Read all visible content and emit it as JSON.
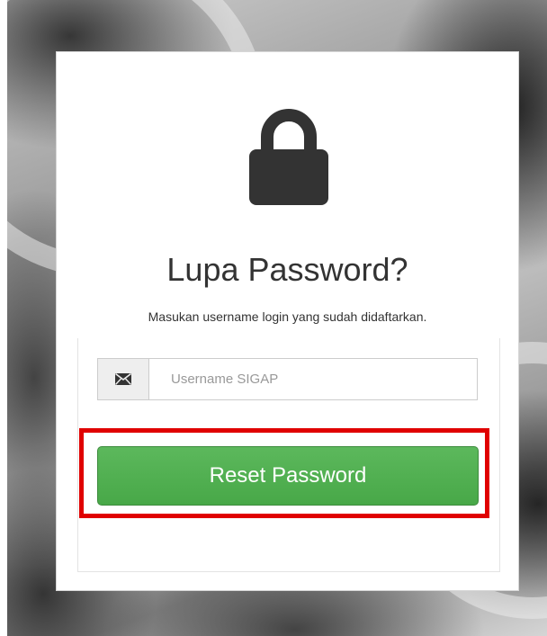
{
  "colors": {
    "button_bg": "#5cb85c",
    "button_text": "#ffffff",
    "highlight_border": "#e00000",
    "lock_icon": "#333333",
    "title_text": "#333333"
  },
  "icons": {
    "header": "lock-icon",
    "input_addon": "envelope-icon"
  },
  "card": {
    "title": "Lupa Password?",
    "subtitle": "Masukan username login yang sudah didaftarkan."
  },
  "form": {
    "username_placeholder": "Username SIGAP",
    "username_value": "",
    "submit_label": "Reset Password"
  }
}
